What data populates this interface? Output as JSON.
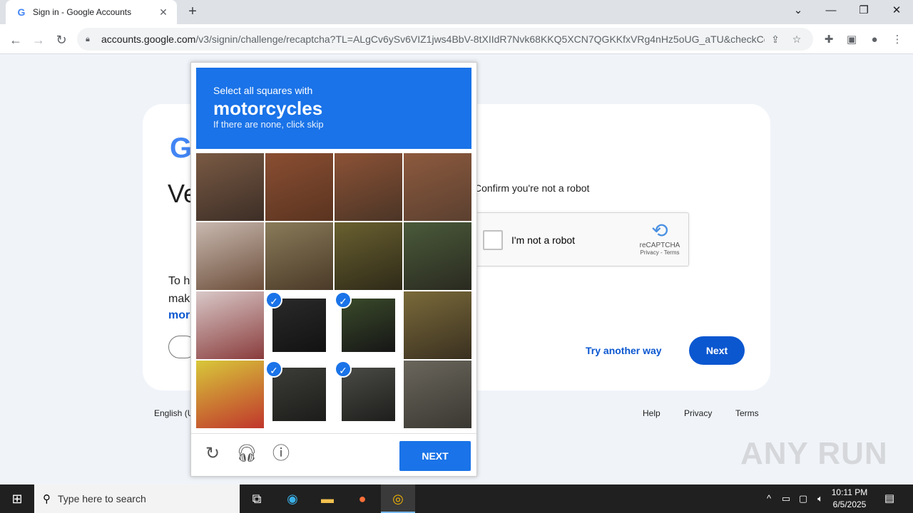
{
  "browser": {
    "tab_title": "Sign in - Google Accounts",
    "favicon_letter": "G",
    "tab_close": "✕",
    "new_tab": "+",
    "url_host": "accounts.google.com",
    "url_path": "/v3/signin/challenge/recaptcha?TL=ALgCv6ySv6VIZ1jws4BbV-8tXIIdR7Nvk68KKQ5XCN7QGKKfxVRg4nHz5oUG_aTU&checkConn...",
    "icons": [
      "back-icon",
      "forward-icon",
      "reload-icon",
      "lock-icon",
      "share-icon",
      "star-icon",
      "extensions-icon",
      "sidepanel-icon",
      "profile-icon",
      "menu-icon"
    ]
  },
  "page": {
    "logo_letter": "G",
    "heading_partial": "Ve",
    "desc_line1": "To h",
    "desc_line2": "mak",
    "desc_link": "mor",
    "confirm_text": "Confirm you're not a robot",
    "recaptcha_label": "I'm not a robot",
    "recaptcha_brand": "reCAPTCHA",
    "recaptcha_links": "Privacy - Terms",
    "try_another": "Try another way",
    "next": "Next",
    "footer_lang": "English (U",
    "footer_help": "Help",
    "footer_privacy": "Privacy",
    "footer_terms": "Terms"
  },
  "challenge": {
    "line1": "Select all squares with",
    "target": "motorcycles",
    "line3": "If there are none, click skip",
    "next": "NEXT",
    "selected_tiles": [
      9,
      10,
      13,
      14
    ],
    "accent": "#1a73e8"
  },
  "watermark": "ANY RUN",
  "taskbar": {
    "search_placeholder": "Type here to search",
    "time": "10:11 PM",
    "date": "6/5/2025"
  }
}
